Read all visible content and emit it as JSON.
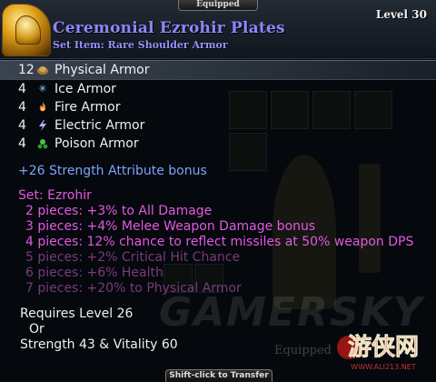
{
  "tooltip": {
    "equipped_tab": "Equipped",
    "item_name": "Ceremonial Ezrohir Plates",
    "item_subtitle": "Set Item: Rare Shoulder Armor",
    "level": "Level 30",
    "stats": [
      {
        "value": "12",
        "label": "Physical Armor",
        "icon": "physical-armor-icon",
        "highlight": true
      },
      {
        "value": "4",
        "label": "Ice Armor",
        "icon": "ice-icon"
      },
      {
        "value": "4",
        "label": "Fire Armor",
        "icon": "fire-icon"
      },
      {
        "value": "4",
        "label": "Electric Armor",
        "icon": "lightning-icon"
      },
      {
        "value": "4",
        "label": "Poison Armor",
        "icon": "poison-icon"
      }
    ],
    "bonus": "+26 Strength Attribute bonus",
    "set": {
      "title": "Set: Ezrohir",
      "lines": [
        {
          "text": "2 pieces: +3% to All Damage",
          "active": true
        },
        {
          "text": "3 pieces: +4% Melee Weapon Damage bonus",
          "active": true
        },
        {
          "text": "4 pieces: 12% chance to reflect missiles at 50% weapon DPS",
          "active": true
        },
        {
          "text": "5 pieces: +2% Critical Hit Chance",
          "active": false
        },
        {
          "text": "6 pieces: +6% Health",
          "active": false
        },
        {
          "text": "7 pieces: +20% to Physical Armor",
          "active": false
        }
      ]
    },
    "requirements": {
      "line1": "Requires Level 26",
      "or": "Or",
      "line2": "Strength 43 & Vitality 60"
    },
    "transfer_tab": "Shift-click to Transfer"
  },
  "watermark": "GAMERSKY",
  "background_label": "Equipped",
  "logo": {
    "text": "游侠网",
    "url_text": "WWW.ALI213.NET"
  },
  "colors": {
    "item_name": "#8f86ff",
    "bonus": "#7aa4ff",
    "set_active": "#e05ae0",
    "set_inactive": "#7a3a7c"
  }
}
